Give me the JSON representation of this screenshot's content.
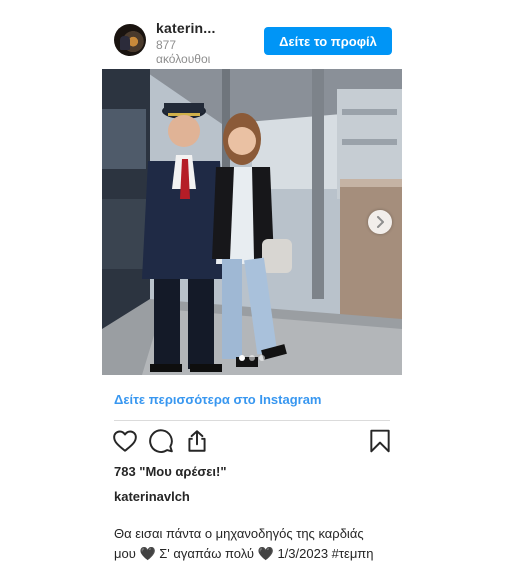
{
  "header": {
    "username": "katerin...",
    "followers_count": "877",
    "followers_label": "ακόλουθοι",
    "profile_button": "Δείτε το προφίλ"
  },
  "post": {
    "image_description_icon": "photo",
    "carousel": {
      "slides": 3,
      "active_index": 0
    },
    "more_link": "Δείτε περισσότερα στο Instagram",
    "likes": "783 \"Μου αρέσει!\"",
    "caption_user": "katerinavlch",
    "caption_line1": "Θα εισαι πάντα ο μηχανοδηγός της καρδιάς",
    "caption_line2": "μου 🖤 Σ' αγαπάω πολύ 🖤 1/3/2023 #τεμπη"
  },
  "icons": {
    "like": "heart-icon",
    "comment": "comment-icon",
    "share": "share-icon",
    "save": "bookmark-icon",
    "next": "chevron-right-icon"
  },
  "colors": {
    "accent": "#0095f6",
    "link": "#3897f0",
    "text": "#262626",
    "muted": "#8e8e8e"
  }
}
